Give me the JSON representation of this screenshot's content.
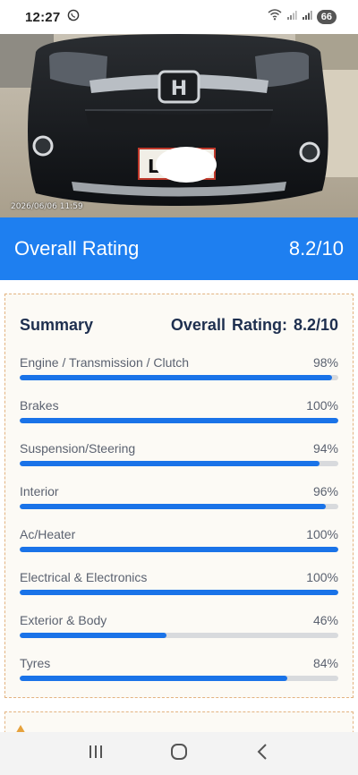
{
  "status_bar": {
    "time": "12:27",
    "battery": "66",
    "icons": [
      "whatsapp-icon",
      "wifi-icon",
      "signal-icon",
      "signal-icon",
      "battery-icon"
    ]
  },
  "photo": {
    "timestamp": "2026/06/06 11:59",
    "plate": "L"
  },
  "banner": {
    "label": "Overall Rating",
    "value": "8.2/10",
    "color": "#1e7ff0"
  },
  "summary": {
    "title": "Summary",
    "overall_label": "Overall Rating:",
    "overall_value": "8.2/10",
    "bar_color": "#1a73e8",
    "items": [
      {
        "label": "Engine / Transmission / Clutch",
        "percent_text": "98%",
        "percent": 98
      },
      {
        "label": "Brakes",
        "percent_text": "100%",
        "percent": 100
      },
      {
        "label": "Suspension/Steering",
        "percent_text": "94%",
        "percent": 94
      },
      {
        "label": "Interior",
        "percent_text": "96%",
        "percent": 96
      },
      {
        "label": "Ac/Heater",
        "percent_text": "100%",
        "percent": 100
      },
      {
        "label": "Electrical & Electronics",
        "percent_text": "100%",
        "percent": 100
      },
      {
        "label": "Exterior & Body",
        "percent_text": "46%",
        "percent": 46
      },
      {
        "label": "Tyres",
        "percent_text": "84%",
        "percent": 84
      }
    ]
  },
  "nav": {
    "icons": [
      "recent-apps-icon",
      "home-icon",
      "back-icon"
    ]
  }
}
